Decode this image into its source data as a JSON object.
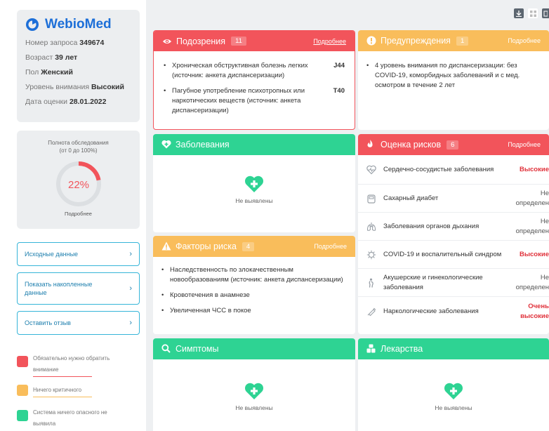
{
  "app": {
    "logo_text": "WebioMed",
    "brand_color": "#1d6fd8",
    "logo_icon": "webiomed-logo-icon"
  },
  "patient": {
    "request_label": "Номер запроса",
    "request_value": "349674",
    "age_label": "Возраст",
    "age_value": "39 лет",
    "sex_label": "Пол",
    "sex_value": "Женский",
    "attention_label": "Уровень внимания",
    "attention_value": "Высокий",
    "date_label": "Дата оценки",
    "date_value": "28.01.2022"
  },
  "completeness": {
    "title_line1": "Полнота обследования",
    "title_line2": "(от 0 до 100%)",
    "percent_text": "22%",
    "fraction": 0.22,
    "more_label": "Подробнее"
  },
  "side_buttons": [
    {
      "label": "Исходные данные"
    },
    {
      "label": "Показать накопленные данные"
    },
    {
      "label": "Оставить отзыв"
    }
  ],
  "legend": [
    {
      "label": "Обязательно нужно обратить внимание",
      "color": "#f2545b"
    },
    {
      "label": "Ничего критичного",
      "color": "#f9bd5b"
    },
    {
      "label": "Система ничего опасного не выявила",
      "color": "#2ed393"
    }
  ],
  "toolbar": {
    "icons": [
      "download-icon",
      "grid-view-icon",
      "list-view-icon"
    ]
  },
  "suspicions": {
    "title": "Подозрения",
    "count": "11",
    "more": "Подробнее",
    "items": [
      {
        "text": "Хроническая обструктивная болезнь легких (источник: анкета диспансеризации)",
        "code": "J44"
      },
      {
        "text": "Пагубное употребление психотропных или наркотических веществ (источник: анкета диспансеризации)",
        "code": "T40"
      }
    ]
  },
  "warnings": {
    "title": "Предупреждения",
    "count": "1",
    "more": "Подробнее",
    "items": [
      {
        "text": "4 уровень внимания по диспансеризации: без COVID-19, коморбидных заболеваний и с мед. осмотром в течение 2 лет"
      }
    ]
  },
  "diseases": {
    "title": "Заболевания",
    "empty_label": "Не выявлены"
  },
  "risks": {
    "title": "Оценка рисков",
    "count": "6",
    "more": "Подробнее",
    "rows": [
      {
        "name": "Сердечно-сосудистые заболевания",
        "value": "Высокие",
        "level": "high",
        "icon": "heart-outline-icon"
      },
      {
        "name": "Сахарный диабет",
        "value": "Не определен",
        "level": "nd",
        "icon": "glucose-meter-icon"
      },
      {
        "name": "Заболевания органов дыхания",
        "value": "Не определен",
        "level": "nd",
        "icon": "lungs-icon"
      },
      {
        "name": "COVID-19 и воспалительный синдром",
        "value": "Высокие",
        "level": "high",
        "icon": "virus-icon"
      },
      {
        "name": "Акушерские и гинекологические заболевания",
        "value": "Не определен",
        "level": "nd",
        "icon": "pregnancy-icon"
      },
      {
        "name": "Наркологические заболевания",
        "value": "Очень высокие",
        "level": "high",
        "icon": "syringe-icon"
      }
    ]
  },
  "risk_factors": {
    "title": "Факторы риска",
    "count": "4",
    "more": "Подробнее",
    "items": [
      {
        "text": "Наследственность по злокачественным новообразованиям (источник: анкета диспансеризации)"
      },
      {
        "text": "Кровотечения в анамнезе"
      },
      {
        "text": "Увеличенная ЧСС в покое"
      }
    ]
  },
  "symptoms": {
    "title": "Симптомы",
    "empty_label": "Не выявлены"
  },
  "drugs": {
    "title": "Лекарства",
    "empty_label": "Не выявлены"
  }
}
